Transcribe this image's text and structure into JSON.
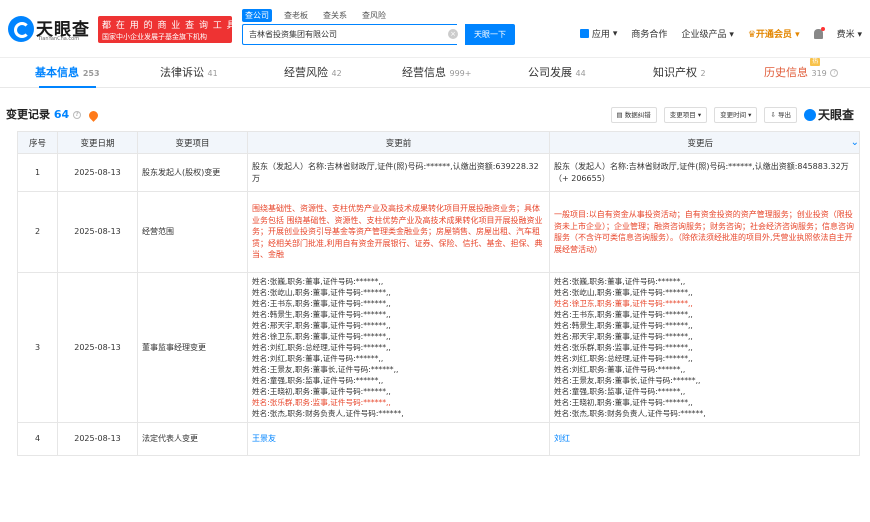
{
  "header": {
    "brand": "天眼查",
    "brand_sub": "TianYanCha.com",
    "slogan_1": "都 在 用 的 商 业 查 询 工 具",
    "slogan_2": "国家中小企业发展子基金旗下机构",
    "search_tabs": [
      "查公司",
      "查老板",
      "查关系",
      "查风险"
    ],
    "search_value": "吉林省投资集团有限公司",
    "search_button": "天眼一下",
    "nav": {
      "app": "应用",
      "coop": "商务合作",
      "enterprise": "企业级产品",
      "vip": "开通会员",
      "user": "费米"
    }
  },
  "tabs": [
    {
      "label": "基本信息",
      "count": "253"
    },
    {
      "label": "法律诉讼",
      "count": "41"
    },
    {
      "label": "经营风险",
      "count": "42"
    },
    {
      "label": "经营信息",
      "count": "999+"
    },
    {
      "label": "公司发展",
      "count": "44"
    },
    {
      "label": "知识产权",
      "count": "2"
    },
    {
      "label": "历史信息",
      "count": "319",
      "hot": "热"
    }
  ],
  "section": {
    "title": "变更记录",
    "count": "64"
  },
  "tools": {
    "analysis": "数据纠错",
    "item": "变更项目",
    "time": "变更时间",
    "export": "导出",
    "logo": "天眼查"
  },
  "table": {
    "headers": [
      "序号",
      "变更日期",
      "变更项目",
      "变更前",
      "变更后"
    ],
    "rows": [
      {
        "no": "1",
        "date": "2025-08-13",
        "item": "股东发起人(股权)变更",
        "before": "股东（发起人）名称:吉林省财政厅,证件(照)号码:******,认缴出资额:639228.32万",
        "after": "股东（发起人）名称:吉林省财政厅,证件(照)号码:******,认缴出资额:845883.32万（+ 206655）"
      },
      {
        "no": "2",
        "date": "2025-08-13",
        "item": "经营范围",
        "before": "围绕基础性、资源性、支柱优势产业及高技术成果转化项目开展投融资业务；具体业务包括 围绕基础性、资源性、支柱优势产业及高技术成果转化项目开展投融资业务；开展创业投资引导基金等资产管理类金融业务；房屋销售、房屋出租、汽车租赁；经相关部门批准,利用自有资金开展银行、证券、保险、信托、基金、担保、典当、金融",
        "after": "一般项目:以自有资金从事投资活动；自有资金投资的资产管理服务；创业投资（限投资未上市企业）；企业管理；融资咨询服务；财务咨询；社会经济咨询服务；信息咨询服务（不含许可类信息咨询服务）。（除依法须经批准的项目外,凭营业执照依法自主开展经营活动）"
      },
      {
        "no": "3",
        "date": "2025-08-13",
        "item": "董事监事经理变更",
        "before": [
          "姓名:张巍,职务:董事,证件号码:******,,",
          "姓名:张屹山,职务:董事,证件号码:******,,",
          "姓名:王书东,职务:董事,证件号码:******,,",
          "姓名:韩景生,职务:董事,证件号码:******,,",
          "姓名:邢天宇,职务:董事,证件号码:******,,",
          "姓名:徐卫东,职务:董事,证件号码:******,,",
          "姓名:刘红,职务:总经理,证件号码:******,,",
          "姓名:刘红,职务:董事,证件号码:******,,",
          "姓名:王景友,职务:董事长,证件号码:******,,",
          "姓名:童强,职务:监事,证件号码:******,,",
          "姓名:王晓初,职务:董事,证件号码:******,,",
          "姓名:张乐群,职务:监事,证件号码:******,,",
          "姓名:张杰,职务:财务负责人,证件号码:******,"
        ],
        "after": [
          "姓名:张巍,职务:董事,证件号码:******,,",
          "姓名:张屹山,职务:董事,证件号码:******,,",
          "姓名:徐卫东,职务:董事,证件号码:******,,",
          "姓名:王书东,职务:董事,证件号码:******,,",
          "姓名:韩景生,职务:董事,证件号码:******,,",
          "姓名:邢天宇,职务:董事,证件号码:******,,",
          "姓名:张乐群,职务:监事,证件号码:******,,",
          "姓名:刘红,职务:总经理,证件号码:******,,",
          "姓名:刘红,职务:董事,证件号码:******,,",
          "姓名:王景友,职务:董事长,证件号码:******,,",
          "姓名:童强,职务:监事,证件号码:******,,",
          "姓名:王晓初,职务:董事,证件号码:******,,",
          "姓名:张杰,职务:财务负责人,证件号码:******,"
        ]
      },
      {
        "no": "4",
        "date": "2025-08-13",
        "item": "法定代表人变更",
        "before": "王景友",
        "after": "刘红"
      }
    ]
  }
}
